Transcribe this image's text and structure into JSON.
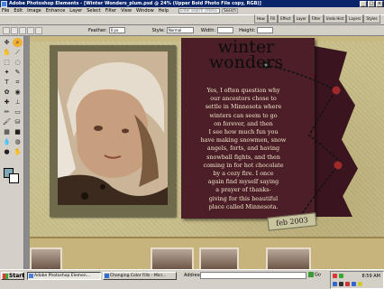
{
  "window": {
    "title": "Adobe Photoshop Elements - [Winter Wonders_plum.psd @ 24% (Upper Bold Photo File copy, RGB)]"
  },
  "menu": [
    "File",
    "Edit",
    "Image",
    "Enhance",
    "Layer",
    "Select",
    "Filter",
    "View",
    "Window",
    "Help"
  ],
  "search": {
    "placeholder": "Enter search criteria",
    "button": "Search"
  },
  "palette_tabs": [
    "How",
    "Fill",
    "Effect",
    "Layer",
    "Filter",
    "Undo Hist",
    "Layers",
    "Styles"
  ],
  "options": {
    "feather_label": "Feather:",
    "feather_value": "0 px",
    "style_label": "Style:",
    "style_value": "Normal",
    "width_label": "Width:",
    "height_label": "Height:"
  },
  "page": {
    "title": "winter wonders",
    "poem": "Yes, I often question why\nour ancestors chose to\nsettle in Minnesota where\nwinters can seem to go\non forever, and then\nI see how much fun you\nhave making snowmen, snow\nangels, forts, and having\nsnowball fights, and then\ncoming in for hot chocolate\nby a cozy fire.  I once\nagain find myself saying\na prayer of thanks-\ngiving for this beautiful\nplace called Minnesota.",
    "date": "feb 2003"
  },
  "taskbar": {
    "start": "Start",
    "tasks": [
      "Adobe Photoshop Elemen...",
      "Changing Color Fills - Micr..."
    ],
    "address_label": "Address",
    "go": "Go",
    "clock": "8:59 AM"
  },
  "colors": {
    "plum": "#4c1e28",
    "khaki": "#c9bf8b",
    "foreground_swatch": "#7ea7b3"
  }
}
